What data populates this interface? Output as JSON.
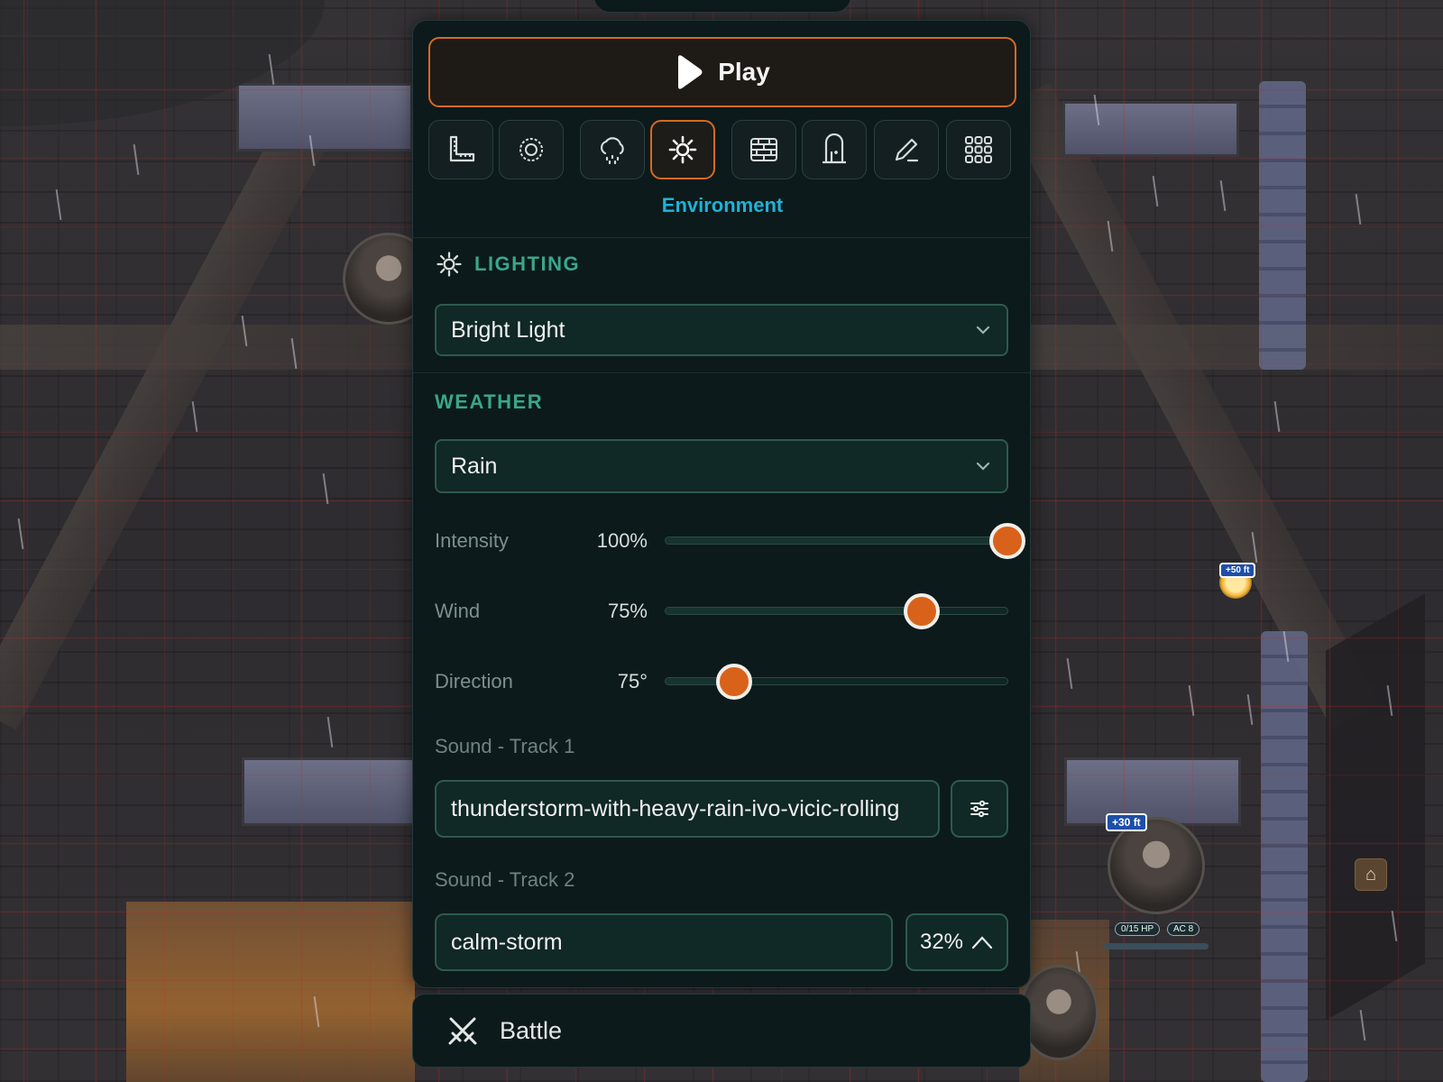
{
  "play": {
    "label": "Play",
    "icon": "play-icon"
  },
  "toolbar": {
    "caption": "Environment",
    "tools": [
      {
        "icon": "ruler-icon"
      },
      {
        "icon": "target-icon"
      },
      {
        "icon": "weather-icon"
      },
      {
        "icon": "sun-icon",
        "active": true
      },
      {
        "icon": "wall-icon"
      },
      {
        "icon": "door-icon"
      },
      {
        "icon": "pencil-icon"
      },
      {
        "icon": "grid-icon"
      }
    ]
  },
  "lighting": {
    "title": "LIGHTING",
    "icon": "sun-icon",
    "selected": "Bright Light"
  },
  "weather": {
    "title": "WEATHER",
    "selected": "Rain",
    "sliders": [
      {
        "label": "Intensity",
        "value_text": "100%",
        "value": 1.0
      },
      {
        "label": "Wind",
        "value_text": "75%",
        "value": 0.75
      },
      {
        "label": "Direction",
        "value_text": "75°",
        "value": 0.2
      }
    ]
  },
  "sound": {
    "track1_label": "Sound - Track 1",
    "track1_value": "thunderstorm-with-heavy-rain-ivo-vicic-rolling",
    "track1_settings_icon": "sliders-icon",
    "track2_label": "Sound - Track 2",
    "track2_value": "calm-storm",
    "track2_volume": "32%",
    "track2_toggle_icon": "chevron-up-icon"
  },
  "battle": {
    "label": "Battle",
    "icon": "crossed-swords-icon"
  },
  "map": {
    "token_badge_1": "+30 ft",
    "token_badge_2": "+50 ft",
    "hp_label": "0/15 HP",
    "ac_label": "AC 8"
  },
  "colors": {
    "accent_orange": "#d9621b",
    "accent_cyan": "#1fb2d8",
    "section_green": "#3aa68a",
    "panel_bg": "#0c1a1b"
  }
}
